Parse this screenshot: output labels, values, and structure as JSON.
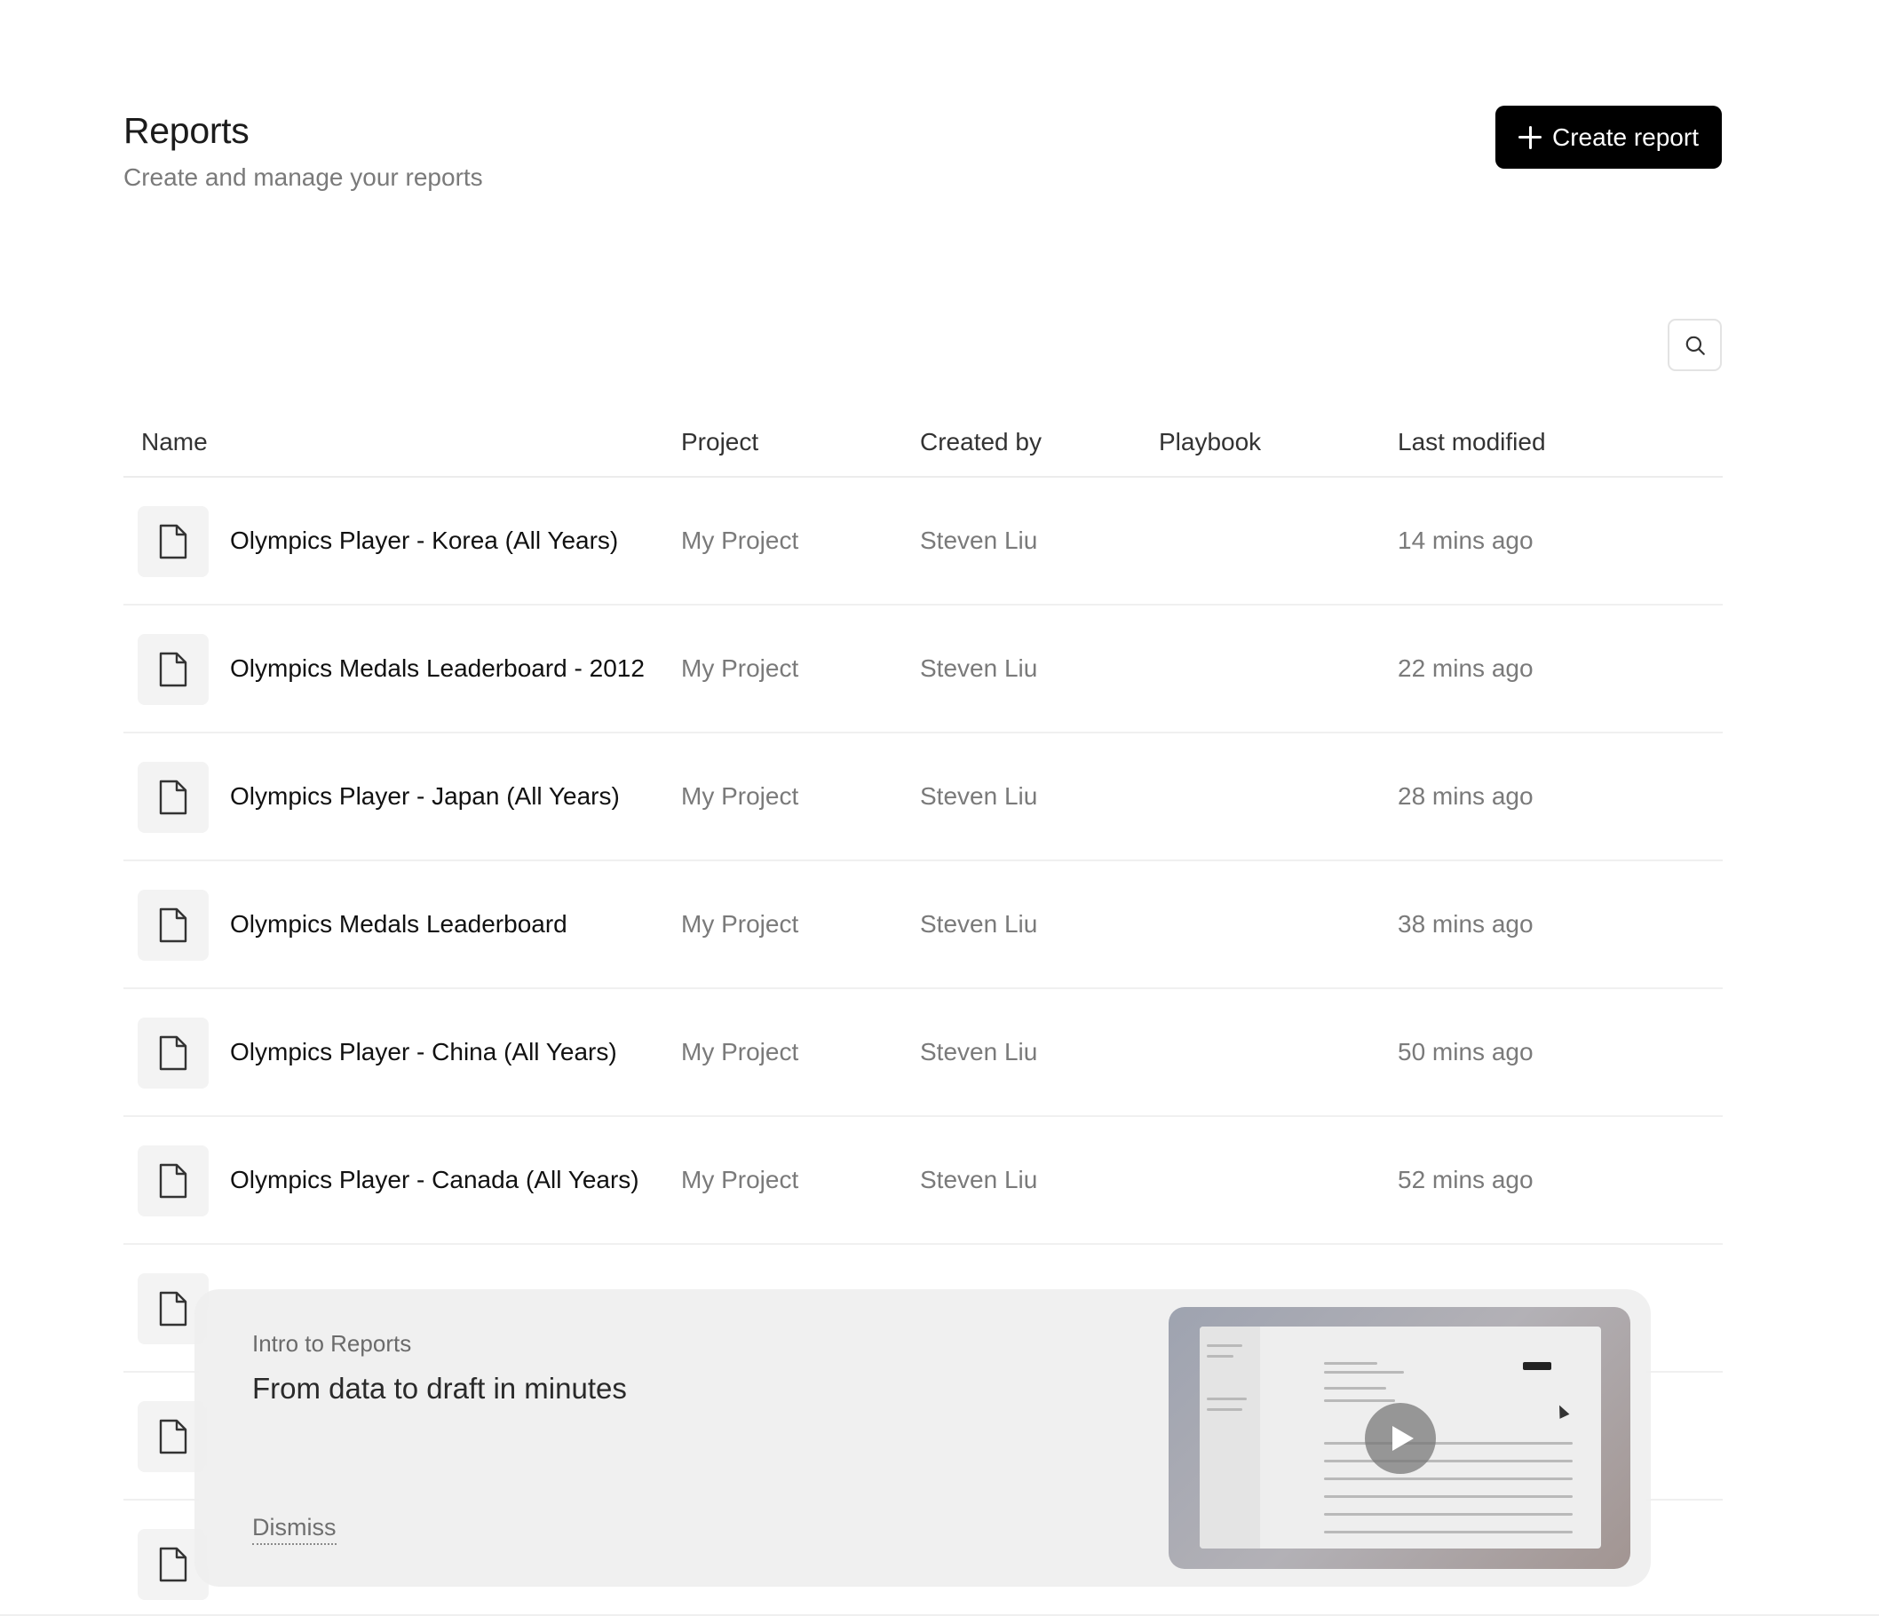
{
  "header": {
    "title": "Reports",
    "subtitle": "Create and manage your reports",
    "create_label": "Create report"
  },
  "table": {
    "columns": [
      "Name",
      "Project",
      "Created by",
      "Playbook",
      "Last modified"
    ],
    "rows": [
      {
        "name": "Olympics Player - Korea (All Years)",
        "project": "My Project",
        "creator": "Steven Liu",
        "playbook": "",
        "modified": "14 mins ago"
      },
      {
        "name": "Olympics Medals Leaderboard - 2012",
        "project": "My Project",
        "creator": "Steven Liu",
        "playbook": "",
        "modified": "22 mins ago"
      },
      {
        "name": "Olympics Player - Japan (All Years)",
        "project": "My Project",
        "creator": "Steven Liu",
        "playbook": "",
        "modified": "28 mins ago"
      },
      {
        "name": "Olympics Medals Leaderboard",
        "project": "My Project",
        "creator": "Steven Liu",
        "playbook": "",
        "modified": "38 mins ago"
      },
      {
        "name": "Olympics Player - China (All Years)",
        "project": "My Project",
        "creator": "Steven Liu",
        "playbook": "",
        "modified": "50 mins ago"
      },
      {
        "name": "Olympics Player - Canada (All Years)",
        "project": "My Project",
        "creator": "Steven Liu",
        "playbook": "",
        "modified": "52 mins ago"
      }
    ]
  },
  "intro_card": {
    "eyebrow": "Intro to Reports",
    "title": "From data to draft in minutes",
    "dismiss_label": "Dismiss"
  },
  "icons": {
    "create": "plus-icon",
    "search": "search-icon",
    "file": "file-icon",
    "play": "play-icon"
  },
  "colors": {
    "primary_button": "#000000",
    "muted_text": "#7a7a7a",
    "tile_bg": "#f3f3f3"
  }
}
